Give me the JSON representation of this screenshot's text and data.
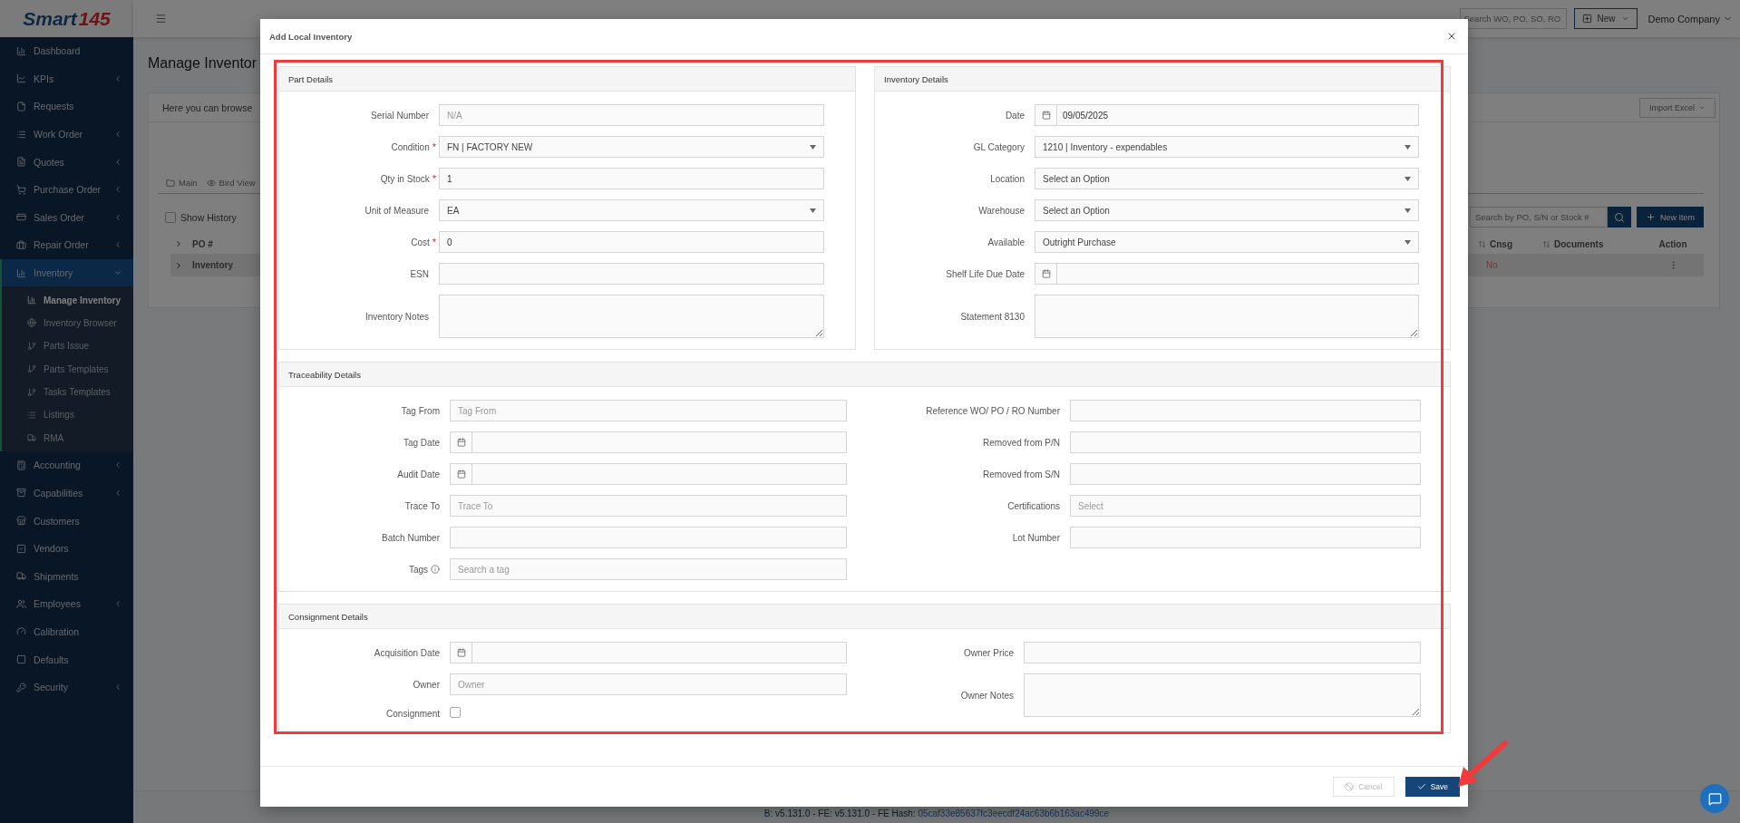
{
  "topbar": {
    "logo": {
      "word": "Smart",
      "number": "145"
    },
    "search": {
      "placeholder": "Search WO, PO, SO, RO"
    },
    "new_button": "New",
    "company": "Demo Company"
  },
  "sidebar": {
    "items": [
      {
        "label": "Dashboard",
        "selected": false
      },
      {
        "label": "KPIs",
        "selected": false,
        "expanded": false
      },
      {
        "label": "Requests",
        "selected": false
      },
      {
        "label": "Work Order",
        "selected": false,
        "expanded": false
      },
      {
        "label": "Quotes",
        "selected": false,
        "expanded": false
      },
      {
        "label": "Purchase Order",
        "selected": false,
        "expanded": false
      },
      {
        "label": "Sales Order",
        "selected": false,
        "expanded": false
      },
      {
        "label": "Repair Order",
        "selected": false,
        "expanded": false
      },
      {
        "label": "Inventory",
        "selected": true,
        "expanded": true,
        "children": [
          {
            "label": "Manage Inventory",
            "selected": true
          },
          {
            "label": "Inventory Browser",
            "selected": false
          },
          {
            "label": "Parts Issue",
            "selected": false
          },
          {
            "label": "Parts Templates",
            "selected": false
          },
          {
            "label": "Tasks Templates",
            "selected": false
          },
          {
            "label": "Listings",
            "selected": false
          },
          {
            "label": "RMA",
            "selected": false
          }
        ]
      },
      {
        "label": "Accounting",
        "selected": false,
        "expanded": false
      },
      {
        "label": "Capabilities",
        "selected": false,
        "expanded": false
      },
      {
        "label": "Customers",
        "selected": false
      },
      {
        "label": "Vendors",
        "selected": false
      },
      {
        "label": "Shipments",
        "selected": false
      },
      {
        "label": "Employees",
        "selected": false,
        "expanded": false
      },
      {
        "label": "Calibration",
        "selected": false
      },
      {
        "label": "Defaults",
        "selected": false
      },
      {
        "label": "Security",
        "selected": false,
        "expanded": false
      }
    ]
  },
  "page": {
    "title": "Manage Inventor",
    "description": "Here you can browse",
    "import_button": "Import Excel",
    "tabs": [
      {
        "label": "Main"
      },
      {
        "label": "Bird View"
      }
    ],
    "show_history": {
      "label": "Show History",
      "checked": false
    },
    "table_search": {
      "placeholder": "Search by PO, S/N or Stock #"
    },
    "new_item_button": "New Item",
    "table": {
      "columns": [
        {
          "label": "PO #",
          "sortable": false
        },
        {
          "label": "Cnsg",
          "sortable": true
        },
        {
          "label": "Documents",
          "sortable": true
        },
        {
          "label": "Action",
          "sortable": false
        }
      ],
      "rows": [
        {
          "group": "Inventory",
          "cnsg": "No"
        }
      ]
    }
  },
  "modal": {
    "title": "Add Local Inventory",
    "top_sections": [
      {
        "title": "Part Details",
        "fields": [
          {
            "label": "Serial Number",
            "kind": "text",
            "placeholder": "N/A"
          },
          {
            "label": "Condition",
            "required_mark": "*",
            "kind": "select",
            "value": "FN | FACTORY NEW"
          },
          {
            "label": "Qty in Stock",
            "required_mark": "*",
            "kind": "text",
            "value": "1"
          },
          {
            "label": "Unit of Measure",
            "kind": "select",
            "value": "EA"
          },
          {
            "label": "Cost",
            "required_mark": "*",
            "kind": "text",
            "value": "0"
          },
          {
            "label": "ESN",
            "kind": "text"
          },
          {
            "label": "Inventory Notes",
            "kind": "textarea"
          }
        ]
      },
      {
        "title": "Inventory Details",
        "fields": [
          {
            "label": "Date",
            "kind": "date",
            "value": "09/05/2025"
          },
          {
            "label": "GL Category",
            "kind": "select",
            "value": "1210 | Inventory - expendables"
          },
          {
            "label": "Location",
            "kind": "select",
            "value": "Select an Option"
          },
          {
            "label": "Warehouse",
            "kind": "select",
            "value": "Select an Option"
          },
          {
            "label": "Available",
            "kind": "select",
            "value": "Outright Purchase"
          },
          {
            "label": "Shelf Life Due Date",
            "kind": "date"
          },
          {
            "label": "Statement 8130",
            "kind": "textarea"
          }
        ]
      }
    ],
    "wide_sections": [
      {
        "title": "Traceability Details",
        "columns": [
          [
            {
              "label": "Tag From",
              "kind": "text",
              "placeholder": "Tag From"
            },
            {
              "label": "Tag Date",
              "kind": "date"
            },
            {
              "label": "Audit Date",
              "kind": "date"
            },
            {
              "label": "Trace To",
              "kind": "text",
              "placeholder": "Trace To"
            },
            {
              "label": "Batch Number",
              "kind": "text"
            },
            {
              "label": "Tags",
              "kind": "text",
              "placeholder": "Search a tag",
              "info_icon": true
            }
          ],
          [
            {
              "label": "Reference WO/ PO / RO Number",
              "kind": "text"
            },
            {
              "label": "Removed from P/N",
              "kind": "text"
            },
            {
              "label": "Removed from S/N",
              "kind": "text"
            },
            {
              "label": "Certifications",
              "kind": "text",
              "placeholder": "Select"
            },
            {
              "label": "Lot Number",
              "kind": "text"
            }
          ]
        ]
      },
      {
        "title": "Consignment Details",
        "columns": [
          [
            {
              "label": "Acquisition Date",
              "kind": "date"
            },
            {
              "label": "Owner",
              "kind": "text",
              "placeholder": "Owner"
            },
            {
              "label": "Consignment",
              "kind": "checkbox",
              "checked": false
            }
          ],
          [
            {
              "label": "Owner Price",
              "kind": "text"
            },
            {
              "label": "Owner Notes",
              "kind": "textarea"
            }
          ]
        ]
      }
    ],
    "buttons": [
      {
        "label": "Cancel",
        "kind": "cancel",
        "disabled": true
      },
      {
        "label": "Save",
        "kind": "save",
        "disabled": false
      }
    ]
  },
  "footer": {
    "version": "B: v5.131.0 - FE: v5.131.0 - FE Hash:",
    "hash": "05caf33e85637fc3eecdf24ac63b6b163ac499ce"
  }
}
